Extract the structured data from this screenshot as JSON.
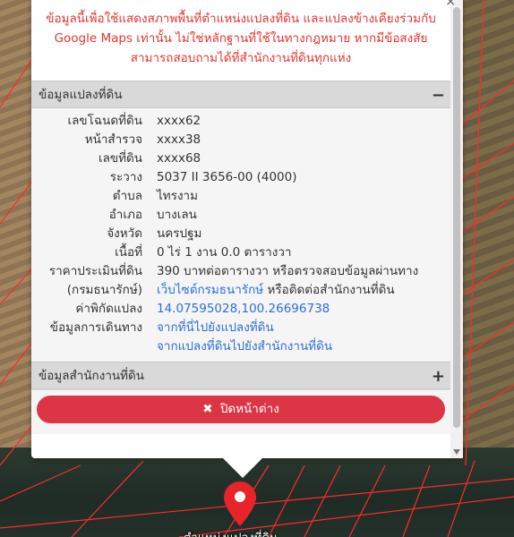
{
  "popup": {
    "close_icon": "×",
    "notice": "ข้อมูลนี้เพื่อใช้แสดงสภาพพื้นที่ตำแหน่งแปลงที่ดิน และแปลงข้างเคียงร่วมกับ Google Maps เท่านั้น ไม่ใช่หลักฐานที่ใช้ในทางกฎหมาย หากมีข้อสงสัยสามารถสอบถามได้ที่สำนักงานที่ดินทุกแห่ง",
    "parcel_section": {
      "title": "ข้อมูลแปลงที่ดิน",
      "toggle": "−",
      "rows": [
        {
          "label": "เลขโฉนดที่ดิน",
          "value": "xxxx62"
        },
        {
          "label": "หน้าสำรวจ",
          "value": "xxxx38"
        },
        {
          "label": "เลขที่ดิน",
          "value": "xxxx68"
        },
        {
          "label": "ระวาง",
          "value": "5037 II 3656-00 (4000)"
        },
        {
          "label": "ตำบล",
          "value": "ไทรงาม"
        },
        {
          "label": "อำเภอ",
          "value": "บางเลน"
        },
        {
          "label": "จังหวัด",
          "value": "นครปฐม"
        },
        {
          "label": "เนื้อที่",
          "value": "0 ไร่ 1 งาน 0.0 ตารางวา"
        }
      ],
      "appraisal": {
        "label1": "ราคาประเมินที่ดิน",
        "value1": "390 บาทต่อตารางวา หรือตรวจสอบข้อมูลผ่านทาง",
        "label2": "(กรมธนารักษ์)",
        "link": "เว็บไซต์กรมธนารักษ์",
        "value2_suffix": " หรือติดต่อสำนักงานที่ดิน"
      },
      "coords": {
        "label": "ค่าพิกัดแปลง",
        "value": "14.07595028,100.26696738"
      },
      "route": {
        "label": "ข้อมูลการเดินทาง",
        "link1": "จากที่นี่ไปยังแปลงที่ดิน",
        "link2": "จากแปลงที่ดินไปยังสำนักงานที่ดิน"
      }
    },
    "office_section": {
      "title": "ข้อมูลสำนักงานที่ดิน",
      "toggle": "+"
    },
    "close_button": {
      "icon": "✖",
      "label": "ปิดหน้าต่าง"
    }
  },
  "map": {
    "pin_color": "#e8232a",
    "pin_label": "ตำแหน่งแปลงที่ดิน"
  }
}
